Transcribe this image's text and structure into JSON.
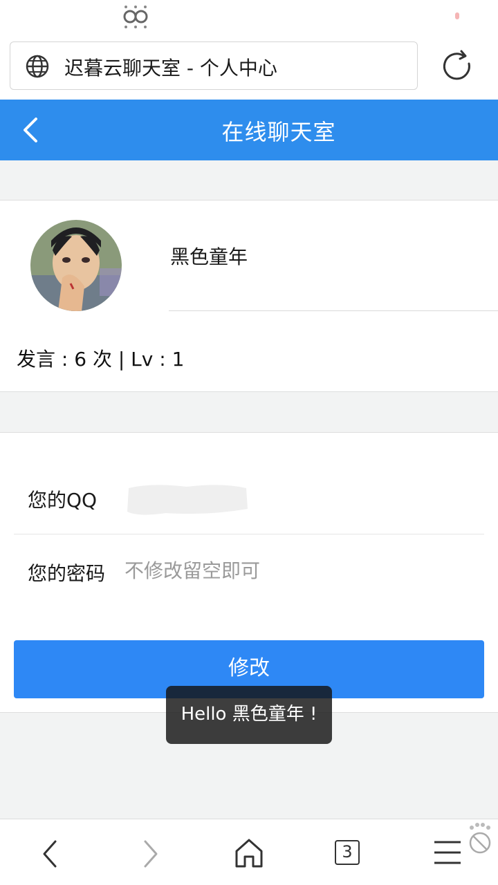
{
  "browser": {
    "address_text": "迟暮云聊天室 - 个人中心"
  },
  "header": {
    "title": "在线聊天室"
  },
  "profile": {
    "username": "黑色童年",
    "stats": "发言 : 6 次 | Lv : 1"
  },
  "form": {
    "qq_label": "您的QQ",
    "password_label": "您的密码",
    "password_placeholder": "不修改留空即可",
    "submit_label": "修改"
  },
  "toast": {
    "message": "Hello 黑色童年 !"
  },
  "bottom_nav": {
    "tab_count": "3"
  },
  "colors": {
    "header_bg": "#2e8ded",
    "button_bg": "#2e88f5",
    "page_bg": "#f2f3f3"
  },
  "icons": [
    "logo-icon",
    "globe-icon",
    "reload-icon",
    "back-icon",
    "avatar",
    "nav-back-icon",
    "nav-forward-icon",
    "home-icon",
    "tabs-icon",
    "menu-icon",
    "extension-icon"
  ]
}
